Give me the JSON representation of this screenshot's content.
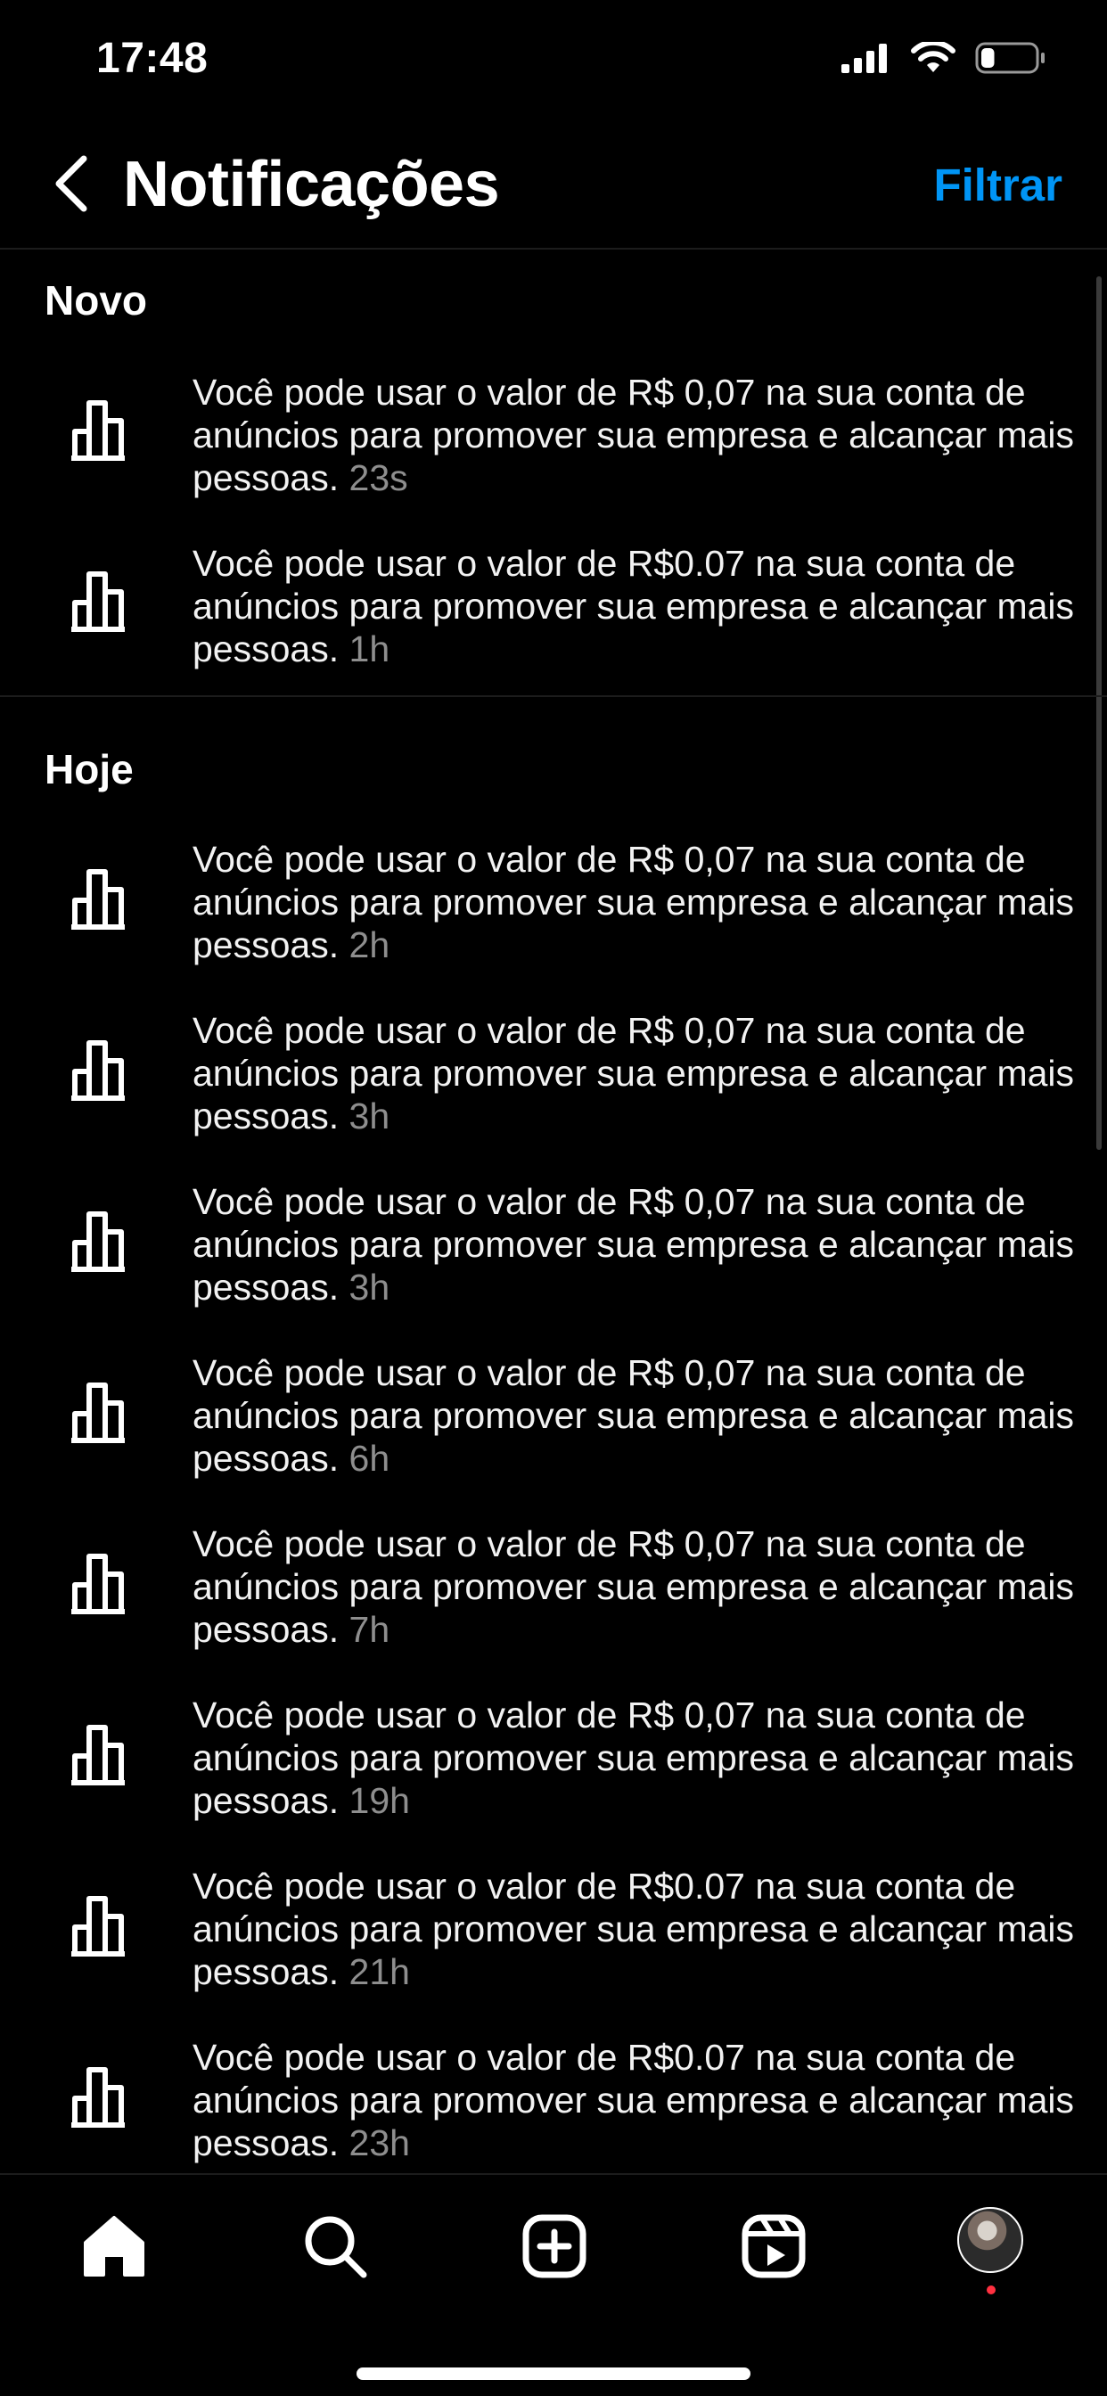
{
  "status_bar": {
    "time": "17:48",
    "battery_percent": 25
  },
  "header": {
    "title": "Notificações",
    "filter_label": "Filtrar"
  },
  "sections": [
    {
      "title": "Novo",
      "items": [
        {
          "text": "Você pode usar o valor de R$ 0,07 na sua conta de anúncios para promover sua empresa e alcançar mais pessoas.",
          "time": "23s",
          "icon": "bar-chart-icon"
        },
        {
          "text": "Você pode usar o valor de R$0.07 na sua conta de anúncios para promover sua empresa e alcançar mais pessoas.",
          "time": "1h",
          "icon": "bar-chart-icon"
        }
      ]
    },
    {
      "title": "Hoje",
      "items": [
        {
          "text": "Você pode usar o valor de R$ 0,07 na sua conta de anúncios para promover sua empresa e alcançar mais pessoas.",
          "time": "2h",
          "icon": "bar-chart-icon"
        },
        {
          "text": "Você pode usar o valor de R$ 0,07 na sua conta de anúncios para promover sua empresa e alcançar mais pessoas.",
          "time": "3h",
          "icon": "bar-chart-icon"
        },
        {
          "text": "Você pode usar o valor de R$ 0,07 na sua conta de anúncios para promover sua empresa e alcançar mais pessoas.",
          "time": "3h",
          "icon": "bar-chart-icon"
        },
        {
          "text": "Você pode usar o valor de R$ 0,07 na sua conta de anúncios para promover sua empresa e alcançar mais pessoas.",
          "time": "6h",
          "icon": "bar-chart-icon"
        },
        {
          "text": "Você pode usar o valor de R$ 0,07 na sua conta de anúncios para promover sua empresa e alcançar mais pessoas.",
          "time": "7h",
          "icon": "bar-chart-icon"
        },
        {
          "text": "Você pode usar o valor de R$ 0,07 na sua conta de anúncios para promover sua empresa e alcançar mais pessoas.",
          "time": "19h",
          "icon": "bar-chart-icon"
        },
        {
          "text": "Você pode usar o valor de R$0.07 na sua conta de anúncios para promover sua empresa e alcançar mais pessoas.",
          "time": "21h",
          "icon": "bar-chart-icon"
        },
        {
          "text": "Você pode usar o valor de R$0.07 na sua conta de anúncios para promover sua empresa e alcançar mais pessoas.",
          "time": "23h",
          "icon": "bar-chart-icon"
        }
      ]
    }
  ],
  "tab_bar": {
    "tabs": [
      {
        "name": "home",
        "icon": "home-icon"
      },
      {
        "name": "search",
        "icon": "search-icon"
      },
      {
        "name": "create",
        "icon": "plus-square-icon"
      },
      {
        "name": "reels",
        "icon": "reels-icon"
      },
      {
        "name": "profile",
        "icon": "avatar"
      }
    ],
    "accent": "#ff3040"
  },
  "colors": {
    "background": "#000000",
    "link": "#0095f6",
    "muted_text": "#8e8e8e"
  }
}
